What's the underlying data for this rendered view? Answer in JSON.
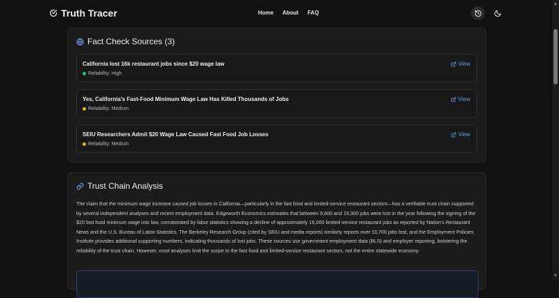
{
  "header": {
    "app_name": "Truth Tracer",
    "nav": [
      "Home",
      "About",
      "FAQ"
    ],
    "icons": {
      "logo": "check-circle-icon",
      "history": "history-icon",
      "theme": "moon-icon"
    }
  },
  "sources": {
    "title": "Fact Check Sources (3)",
    "icon": "globe-icon",
    "view_label": "View",
    "items": [
      {
        "title": "California lost 16k restaurant jobs since $20 wage law",
        "reliability": "Reliability: High",
        "level": "high"
      },
      {
        "title": "Yes, California's Fast-Food Minimum Wage Law Has Killed Thousands of Jobs",
        "reliability": "Reliability: Medium",
        "level": "medium"
      },
      {
        "title": "SEIU Researchers Admit $20 Wage Law Caused Fast Food Job Losses",
        "reliability": "Reliability: Medium",
        "level": "medium"
      }
    ]
  },
  "trust_chain": {
    "title": "Trust Chain Analysis",
    "icon": "link-icon",
    "text": "The claim that the minimum wage increase caused job losses in California—particularly in the fast food and limited-service restaurant sectors—has a verifiable trust chain supported by several independent analyses and recent employment data. Edgeworth Economics estimates that between 9,600 and 19,300 jobs were lost in the year following the signing of the $20 fast food minimum wage into law, corroborated by labor statistics showing a decline of approximately 16,000 limited-service restaurant jobs as reported by Nation's Restaurant News and the U.S. Bureau of Labor Statistics. The Berkeley Research Group (cited by SEIU and media reports) similarly reports over 10,700 jobs lost, and the Employment Policies Institute provides additional supporting numbers, indicating thousands of lost jobs. These sources use government employment data (BLS) and employer reporting, bolstering the reliability of the trust chain. However, most analyses limit the scope to the fast food and limited-service restaurant sectors, not the entire statewide economy."
  },
  "colors": {
    "accent": "#60a5fa",
    "high": "#22c55e",
    "medium": "#eab308",
    "background": "#111111",
    "card": "#1b1b1b"
  }
}
